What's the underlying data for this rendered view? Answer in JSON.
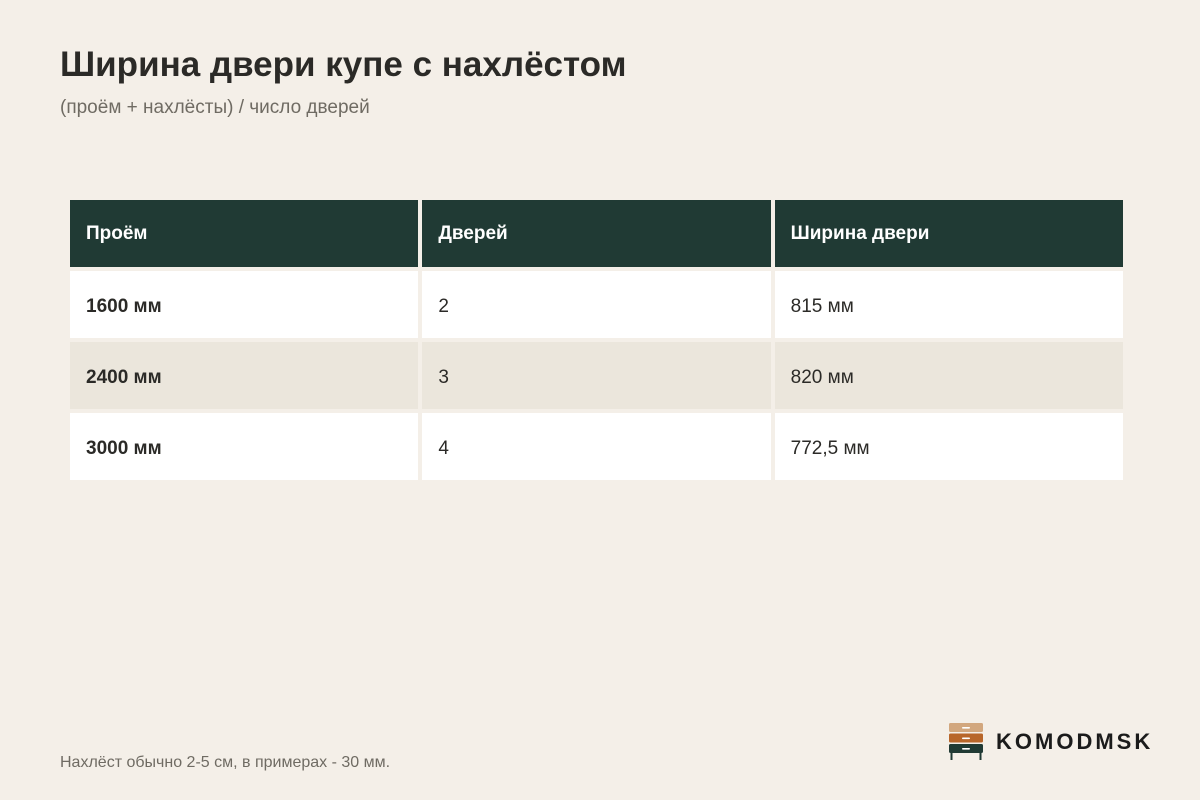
{
  "title": "Ширина двери купе с нахлёстом",
  "subtitle": "(проём + нахлёсты) / число дверей",
  "table": {
    "headers": [
      "Проём",
      "Дверей",
      "Ширина двери"
    ],
    "rows": [
      [
        "1600 мм",
        "2",
        "815 мм"
      ],
      [
        "2400 мм",
        "3",
        "820 мм"
      ],
      [
        "3000 мм",
        "4",
        "772,5 мм"
      ]
    ]
  },
  "footnote": "Нахлёст обычно 2-5 см, в примерах - 30 мм.",
  "logo": {
    "text": "KOMODMSK",
    "icon": "chest-of-drawers-icon"
  },
  "colors": {
    "background": "#f4efe8",
    "header_bg": "#203a34",
    "row_white": "#ffffff",
    "row_beige": "#ebe6dc",
    "text": "#2b2a27",
    "muted_text": "#6f6b63",
    "logo_drawer_top": "#d2a77e",
    "logo_drawer_middle": "#b8662a",
    "logo_drawer_bottom": "#203a34"
  }
}
